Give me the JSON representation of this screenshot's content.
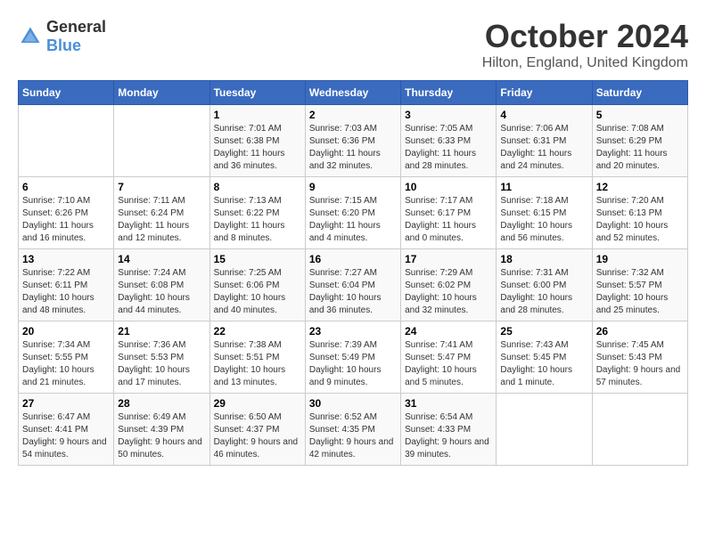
{
  "header": {
    "logo_general": "General",
    "logo_blue": "Blue",
    "month": "October 2024",
    "location": "Hilton, England, United Kingdom"
  },
  "weekdays": [
    "Sunday",
    "Monday",
    "Tuesday",
    "Wednesday",
    "Thursday",
    "Friday",
    "Saturday"
  ],
  "weeks": [
    [
      {
        "day": "",
        "info": ""
      },
      {
        "day": "",
        "info": ""
      },
      {
        "day": "1",
        "info": "Sunrise: 7:01 AM\nSunset: 6:38 PM\nDaylight: 11 hours and 36 minutes."
      },
      {
        "day": "2",
        "info": "Sunrise: 7:03 AM\nSunset: 6:36 PM\nDaylight: 11 hours and 32 minutes."
      },
      {
        "day": "3",
        "info": "Sunrise: 7:05 AM\nSunset: 6:33 PM\nDaylight: 11 hours and 28 minutes."
      },
      {
        "day": "4",
        "info": "Sunrise: 7:06 AM\nSunset: 6:31 PM\nDaylight: 11 hours and 24 minutes."
      },
      {
        "day": "5",
        "info": "Sunrise: 7:08 AM\nSunset: 6:29 PM\nDaylight: 11 hours and 20 minutes."
      }
    ],
    [
      {
        "day": "6",
        "info": "Sunrise: 7:10 AM\nSunset: 6:26 PM\nDaylight: 11 hours and 16 minutes."
      },
      {
        "day": "7",
        "info": "Sunrise: 7:11 AM\nSunset: 6:24 PM\nDaylight: 11 hours and 12 minutes."
      },
      {
        "day": "8",
        "info": "Sunrise: 7:13 AM\nSunset: 6:22 PM\nDaylight: 11 hours and 8 minutes."
      },
      {
        "day": "9",
        "info": "Sunrise: 7:15 AM\nSunset: 6:20 PM\nDaylight: 11 hours and 4 minutes."
      },
      {
        "day": "10",
        "info": "Sunrise: 7:17 AM\nSunset: 6:17 PM\nDaylight: 11 hours and 0 minutes."
      },
      {
        "day": "11",
        "info": "Sunrise: 7:18 AM\nSunset: 6:15 PM\nDaylight: 10 hours and 56 minutes."
      },
      {
        "day": "12",
        "info": "Sunrise: 7:20 AM\nSunset: 6:13 PM\nDaylight: 10 hours and 52 minutes."
      }
    ],
    [
      {
        "day": "13",
        "info": "Sunrise: 7:22 AM\nSunset: 6:11 PM\nDaylight: 10 hours and 48 minutes."
      },
      {
        "day": "14",
        "info": "Sunrise: 7:24 AM\nSunset: 6:08 PM\nDaylight: 10 hours and 44 minutes."
      },
      {
        "day": "15",
        "info": "Sunrise: 7:25 AM\nSunset: 6:06 PM\nDaylight: 10 hours and 40 minutes."
      },
      {
        "day": "16",
        "info": "Sunrise: 7:27 AM\nSunset: 6:04 PM\nDaylight: 10 hours and 36 minutes."
      },
      {
        "day": "17",
        "info": "Sunrise: 7:29 AM\nSunset: 6:02 PM\nDaylight: 10 hours and 32 minutes."
      },
      {
        "day": "18",
        "info": "Sunrise: 7:31 AM\nSunset: 6:00 PM\nDaylight: 10 hours and 28 minutes."
      },
      {
        "day": "19",
        "info": "Sunrise: 7:32 AM\nSunset: 5:57 PM\nDaylight: 10 hours and 25 minutes."
      }
    ],
    [
      {
        "day": "20",
        "info": "Sunrise: 7:34 AM\nSunset: 5:55 PM\nDaylight: 10 hours and 21 minutes."
      },
      {
        "day": "21",
        "info": "Sunrise: 7:36 AM\nSunset: 5:53 PM\nDaylight: 10 hours and 17 minutes."
      },
      {
        "day": "22",
        "info": "Sunrise: 7:38 AM\nSunset: 5:51 PM\nDaylight: 10 hours and 13 minutes."
      },
      {
        "day": "23",
        "info": "Sunrise: 7:39 AM\nSunset: 5:49 PM\nDaylight: 10 hours and 9 minutes."
      },
      {
        "day": "24",
        "info": "Sunrise: 7:41 AM\nSunset: 5:47 PM\nDaylight: 10 hours and 5 minutes."
      },
      {
        "day": "25",
        "info": "Sunrise: 7:43 AM\nSunset: 5:45 PM\nDaylight: 10 hours and 1 minute."
      },
      {
        "day": "26",
        "info": "Sunrise: 7:45 AM\nSunset: 5:43 PM\nDaylight: 9 hours and 57 minutes."
      }
    ],
    [
      {
        "day": "27",
        "info": "Sunrise: 6:47 AM\nSunset: 4:41 PM\nDaylight: 9 hours and 54 minutes."
      },
      {
        "day": "28",
        "info": "Sunrise: 6:49 AM\nSunset: 4:39 PM\nDaylight: 9 hours and 50 minutes."
      },
      {
        "day": "29",
        "info": "Sunrise: 6:50 AM\nSunset: 4:37 PM\nDaylight: 9 hours and 46 minutes."
      },
      {
        "day": "30",
        "info": "Sunrise: 6:52 AM\nSunset: 4:35 PM\nDaylight: 9 hours and 42 minutes."
      },
      {
        "day": "31",
        "info": "Sunrise: 6:54 AM\nSunset: 4:33 PM\nDaylight: 9 hours and 39 minutes."
      },
      {
        "day": "",
        "info": ""
      },
      {
        "day": "",
        "info": ""
      }
    ]
  ]
}
